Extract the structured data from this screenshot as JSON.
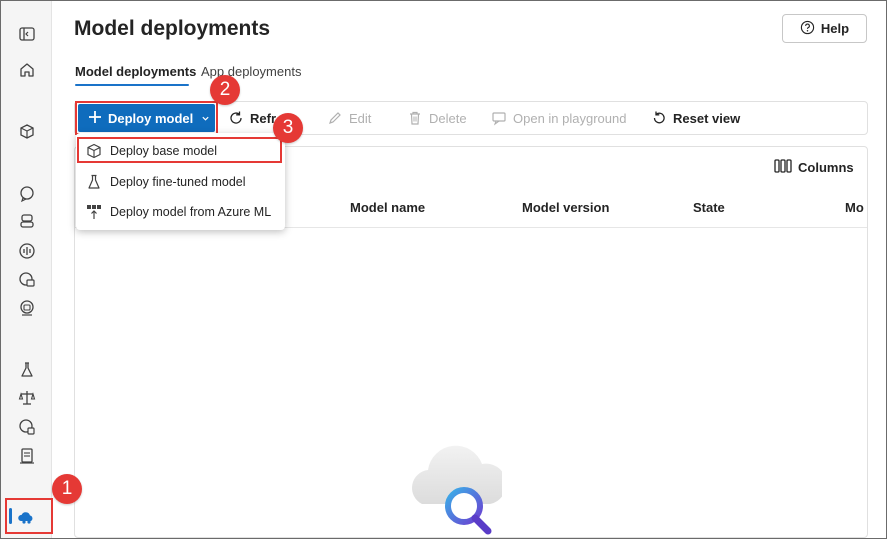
{
  "page": {
    "title": "Model deployments",
    "help_label": "Help"
  },
  "tabs": [
    {
      "label": "Model deployments",
      "active": true
    },
    {
      "label": "App deployments",
      "active": false
    }
  ],
  "toolbar": {
    "deploy_label": "Deploy model",
    "refresh_label": "Refr",
    "edit_label": "Edit",
    "delete_label": "Delete",
    "playground_label": "Open in playground",
    "reset_label": "Reset view",
    "columns_label": "Columns"
  },
  "deploy_menu": {
    "items": [
      {
        "label": "Deploy base model",
        "icon": "cube-icon"
      },
      {
        "label": "Deploy fine-tuned model",
        "icon": "flask-icon"
      },
      {
        "label": "Deploy model from Azure ML",
        "icon": "azure-ml-icon"
      }
    ]
  },
  "table": {
    "columns": [
      "Model name",
      "Model version",
      "State",
      "Mo"
    ]
  },
  "badges": [
    "1",
    "2",
    "3"
  ],
  "colors": {
    "accent": "#0f6cbd",
    "highlight": "#e53935"
  }
}
